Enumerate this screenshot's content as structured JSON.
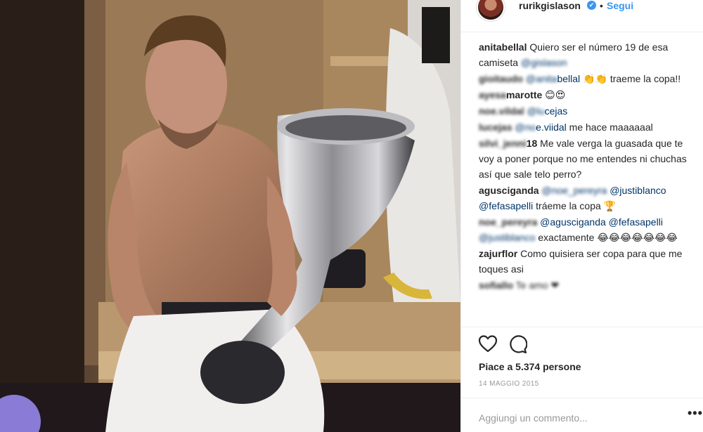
{
  "header": {
    "username": "rurikgislason",
    "verified_mark": "✔",
    "separator": "•",
    "follow_label": "Segui"
  },
  "comments": [
    {
      "user": "anitabellal",
      "text": " Quiero ser el número 19 de esa camiseta ",
      "mention_blurred": "@gislason"
    },
    {
      "user_blurred": "gioitaudo",
      "mention_blurred": "@anita",
      "mention": "bellal",
      "text": " 👏👏 traeme la copa!!"
    },
    {
      "user_blurred": "ayesa",
      "user": "marotte",
      "text": " 😊😍"
    },
    {
      "user_blurred": "noe.vildal",
      "mention_blurred": "@lu",
      "mention": "cejas",
      "text": ""
    },
    {
      "user_blurred": "lucejas",
      "mention_blurred": "@no",
      "mention": "e.viidal",
      "text": " me hace maaaaaal"
    },
    {
      "user_blurred": "silvi_jenni",
      "user": "18",
      "text": " Me vale verga la guasada que te voy a poner porque no me entendes ni chuchas así que sale telo perro?"
    },
    {
      "user": "agusciganda",
      "mention_blurred": "@noe_pereyra",
      "mention": " @justiblanco @fefasapelli",
      "text": " tráeme la copa 🏆"
    },
    {
      "user_blurred": "noe_pereyra",
      "mention": "@agusciganda @fefasapelli",
      "mention_blurred": " @justiblanco",
      "text": " exactamente 😂😂😂😂😂😂😂"
    },
    {
      "user": "zajurflor",
      "text": " Como quisiera ser copa para que me toques asi"
    },
    {
      "user_blurred": "sofiallo",
      "text": " Te amo ❤"
    }
  ],
  "actions": {
    "like_icon": "heart-outline-icon",
    "comment_icon": "speech-bubble-icon"
  },
  "likes_text": "Piace a 5.374 persone",
  "date": "14 MAGGIO 2015",
  "add_comment": {
    "placeholder": "Aggiungi un commento..."
  },
  "more_label": "•••",
  "colors": {
    "link_blue": "#3897f0",
    "mention_blue": "#003569",
    "text": "#262626",
    "muted": "#999999",
    "border": "#efefef"
  }
}
